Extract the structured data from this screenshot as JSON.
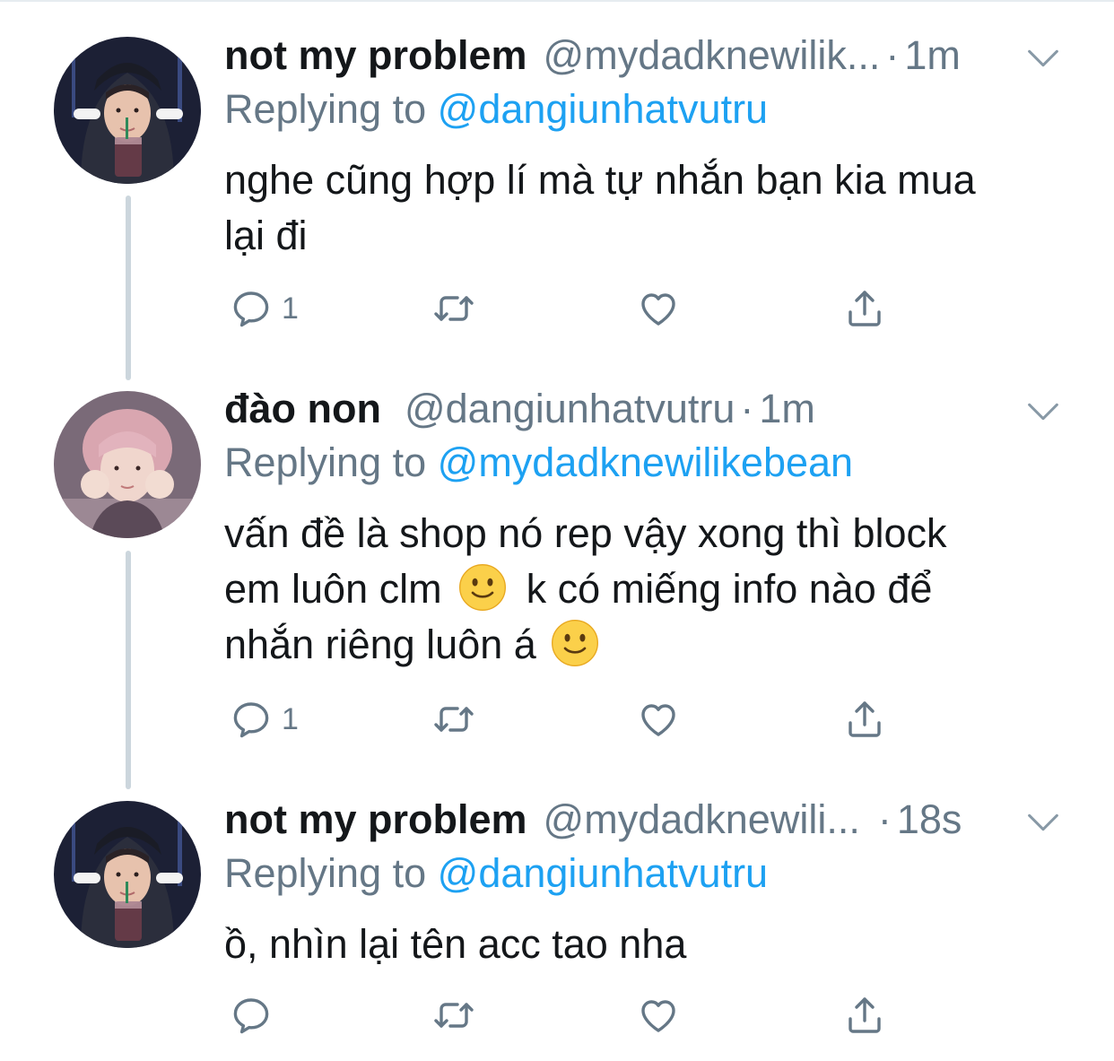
{
  "tweets": [
    {
      "name": "not my problem",
      "handle": "@mydadknewilik...",
      "dot": "·",
      "time": "1m",
      "reply_label": "Replying to ",
      "reply_to": "@dangiunhatvutru",
      "text_lines": [
        "nghe cũng hợp lí mà tự nhắn bạn kia mua",
        "lại đi"
      ],
      "reply_count": "1",
      "avatar_icon": "avatar-hoodie-icon"
    },
    {
      "name": "đào non",
      "handle": "@dangiunhatvutru",
      "dot": "·",
      "time": "1m",
      "reply_label": "Replying to ",
      "reply_to": "@mydadknewilikebean",
      "line1": "vấn đề là shop nó rep vậy xong thì block",
      "line2a": "em luôn clm",
      "line2b": "k có miếng info nào để",
      "line3": "nhắn riêng luôn á",
      "emoji": "slightly-smiling-face-icon",
      "reply_count": "1",
      "avatar_icon": "avatar-pink-hair-icon"
    },
    {
      "name": "not my problem",
      "handle": "@mydadknewili...",
      "dot": "·",
      "time": "18s",
      "reply_label": "Replying to ",
      "reply_to": "@dangiunhatvutru",
      "text_lines": [
        "ồ, nhìn lại tên acc tao nha"
      ],
      "reply_count": "",
      "avatar_icon": "avatar-hoodie-icon"
    }
  ],
  "icons": {
    "reply": "reply-icon",
    "retweet": "retweet-icon",
    "like": "heart-icon",
    "share": "share-icon",
    "menu": "chevron-down-icon"
  },
  "colors": {
    "text": "#14171a",
    "secondary": "#657786",
    "accent": "#1da1f2",
    "thread_line": "#ccd6dd"
  }
}
